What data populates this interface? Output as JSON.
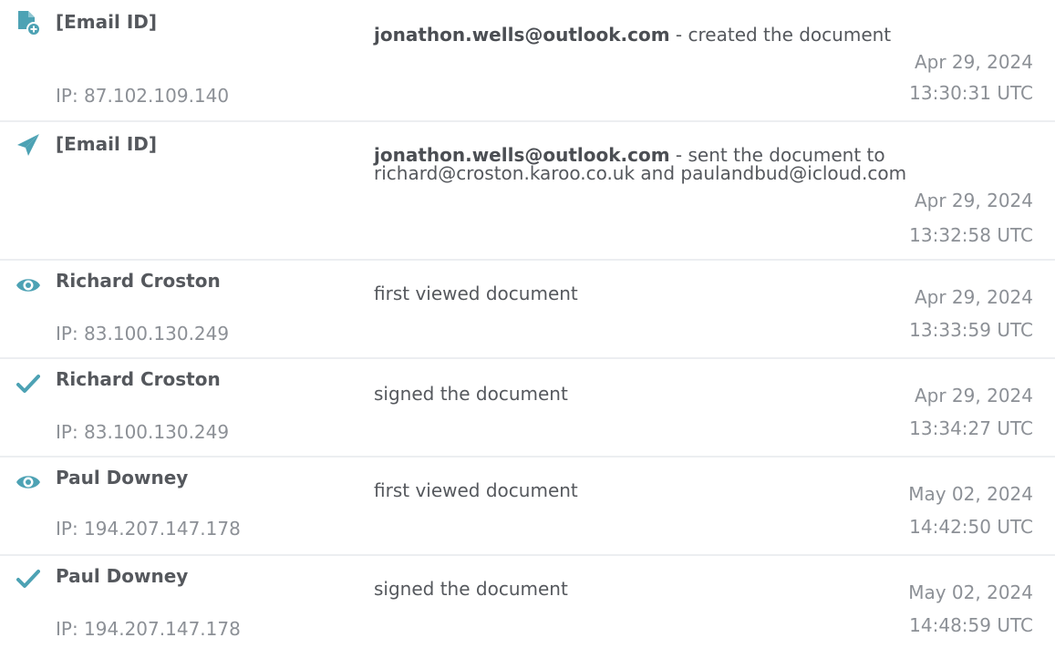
{
  "colors": {
    "accent": "#4da2b4",
    "text_dark": "#55585d",
    "text_muted": "#8c9096",
    "divider": "#eceef1"
  },
  "events": [
    {
      "icon": "document-add-icon",
      "actor": "[Email ID]",
      "ip": "IP: 87.102.109.140",
      "action_user": "jonathon.wells@outlook.com",
      "action_text": " - created the document",
      "date": "Apr 29, 2024",
      "time": "13:30:31 UTC"
    },
    {
      "icon": "paper-plane-icon",
      "actor": "[Email ID]",
      "ip": "",
      "action_user": "jonathon.wells@outlook.com",
      "action_text": " - sent the document to richard@croston.karoo.co.uk and paulandbud@icloud.com",
      "date": "Apr 29, 2024",
      "time": "13:32:58 UTC"
    },
    {
      "icon": "eye-icon",
      "actor": "Richard Croston",
      "ip": "IP: 83.100.130.249",
      "action_user": "",
      "action_text": "first viewed document",
      "date": "Apr 29, 2024",
      "time": "13:33:59 UTC"
    },
    {
      "icon": "checkmark-icon",
      "actor": "Richard Croston",
      "ip": "IP: 83.100.130.249",
      "action_user": "",
      "action_text": "signed the document",
      "date": "Apr 29, 2024",
      "time": "13:34:27 UTC"
    },
    {
      "icon": "eye-icon",
      "actor": "Paul Downey",
      "ip": "IP: 194.207.147.178",
      "action_user": "",
      "action_text": "first viewed document",
      "date": "May 02, 2024",
      "time": "14:42:50 UTC"
    },
    {
      "icon": "checkmark-icon",
      "actor": "Paul Downey",
      "ip": "IP: 194.207.147.178",
      "action_user": "",
      "action_text": "signed the document",
      "date": "May 02, 2024",
      "time": "14:48:59 UTC"
    }
  ]
}
